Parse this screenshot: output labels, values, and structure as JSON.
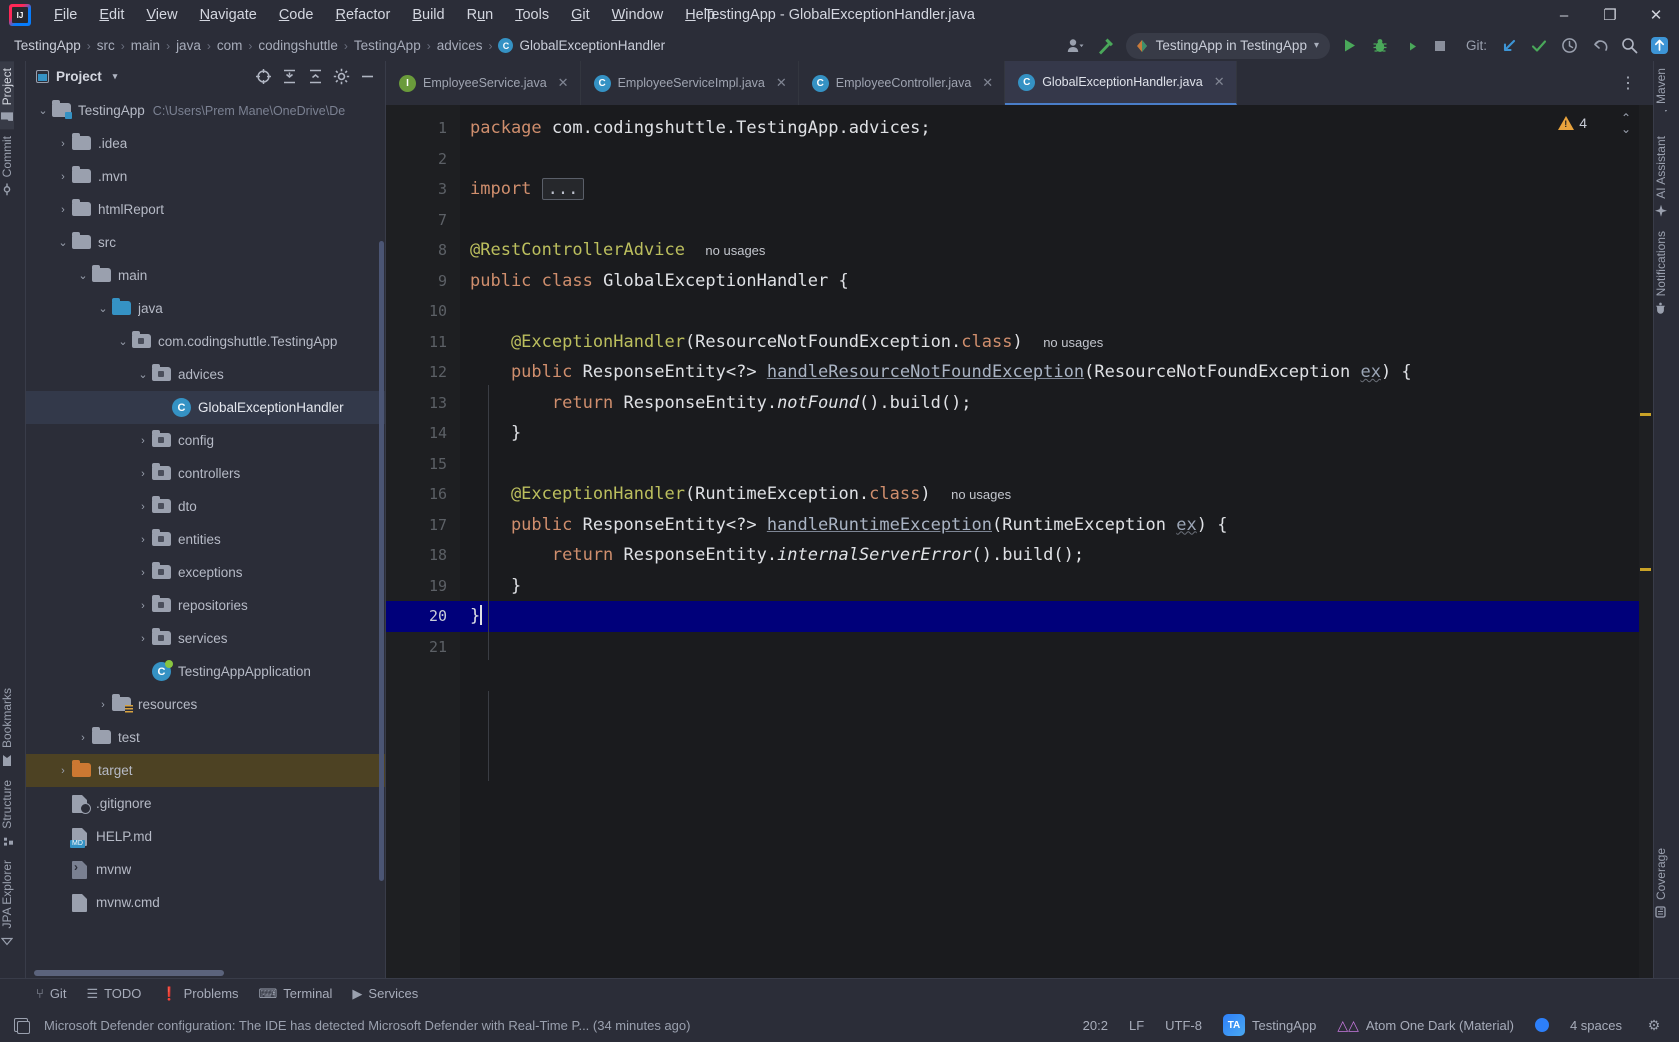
{
  "window": {
    "title": "TestingApp - GlobalExceptionHandler.java",
    "minimize": "–",
    "maximize": "❐",
    "close": "✕"
  },
  "menu": [
    {
      "label": "File",
      "mnemonic": "F"
    },
    {
      "label": "Edit",
      "mnemonic": "E"
    },
    {
      "label": "View",
      "mnemonic": "V"
    },
    {
      "label": "Navigate",
      "mnemonic": "N"
    },
    {
      "label": "Code",
      "mnemonic": "C"
    },
    {
      "label": "Refactor",
      "mnemonic": "R"
    },
    {
      "label": "Build",
      "mnemonic": "B"
    },
    {
      "label": "Run",
      "mnemonic": "u"
    },
    {
      "label": "Tools",
      "mnemonic": "T"
    },
    {
      "label": "Git",
      "mnemonic": "G"
    },
    {
      "label": "Window",
      "mnemonic": "W"
    },
    {
      "label": "Help",
      "mnemonic": "H"
    }
  ],
  "breadcrumb": {
    "items": [
      "TestingApp",
      "src",
      "main",
      "java",
      "com",
      "codingshuttle",
      "TestingApp",
      "advices"
    ],
    "current": "GlobalExceptionHandler",
    "current_icon": "class-icon",
    "separator": "›"
  },
  "toolbar": {
    "account_icon": "user-icon",
    "account_caret": "▾",
    "build_icon": "hammer-icon",
    "run_config": "TestingApp in TestingApp",
    "run_config_icon": "spring-boot-icon",
    "run_config_caret": "▾",
    "run_icon": "run-icon",
    "debug_icon": "debug-icon",
    "run_coverage_icon": "run-with-coverage-icon",
    "stop_icon": "stop-icon",
    "git_label": "Git:",
    "git_update_icon": "update-project-icon",
    "git_commit_icon": "commit-checkmark-icon",
    "git_history_icon": "history-clock-icon",
    "git_rollback_icon": "rollback-icon",
    "search_icon": "search-icon",
    "updates_icon": "updates-arrow-icon"
  },
  "left_rail": [
    {
      "label": "Project",
      "icon": "project-folder-icon",
      "active": true
    },
    {
      "label": "Commit",
      "icon": "commit-icon",
      "active": false
    },
    {
      "label": "Bookmarks",
      "icon": "bookmark-icon",
      "active": false
    },
    {
      "label": "Structure",
      "icon": "structure-icon",
      "active": false
    },
    {
      "label": "JPA Explorer",
      "icon": "jpa-icon",
      "active": false
    }
  ],
  "right_rail": [
    {
      "label": "Maven",
      "icon": "maven-m-icon"
    },
    {
      "label": "AI Assistant",
      "icon": "ai-assistant-icon"
    },
    {
      "label": "Notifications",
      "icon": "notifications-bell-icon"
    },
    {
      "label": "Coverage",
      "icon": "coverage-icon"
    }
  ],
  "project_panel": {
    "title": "Project",
    "caret": "▾",
    "actions": [
      {
        "name": "select-opened-file-icon",
        "glyph": "⊕"
      },
      {
        "name": "expand-all-icon",
        "glyph": "⤒"
      },
      {
        "name": "collapse-all-icon",
        "glyph": "⤓"
      },
      {
        "name": "settings-gear-icon",
        "glyph": "⚙"
      },
      {
        "name": "hide-panel-icon",
        "glyph": "—"
      }
    ],
    "tree": [
      {
        "label": "TestingApp",
        "path": "C:\\Users\\Prem Mane\\OneDrive\\De",
        "depth": 0,
        "arrow": "⌄",
        "icon": "project-root-folder",
        "state": "normal"
      },
      {
        "label": ".idea",
        "depth": 1,
        "arrow": "›",
        "icon": "folder",
        "state": "normal"
      },
      {
        "label": ".mvn",
        "depth": 1,
        "arrow": "›",
        "icon": "folder",
        "state": "normal"
      },
      {
        "label": "htmlReport",
        "depth": 1,
        "arrow": "›",
        "icon": "folder",
        "state": "normal"
      },
      {
        "label": "src",
        "depth": 1,
        "arrow": "⌄",
        "icon": "folder",
        "state": "normal"
      },
      {
        "label": "main",
        "depth": 2,
        "arrow": "⌄",
        "icon": "folder",
        "state": "normal"
      },
      {
        "label": "java",
        "depth": 3,
        "arrow": "⌄",
        "icon": "source-folder",
        "state": "normal"
      },
      {
        "label": "com.codingshuttle.TestingApp",
        "depth": 4,
        "arrow": "⌄",
        "icon": "package",
        "state": "normal"
      },
      {
        "label": "advices",
        "depth": 5,
        "arrow": "⌄",
        "icon": "package",
        "state": "normal"
      },
      {
        "label": "GlobalExceptionHandler",
        "depth": 6,
        "arrow": "",
        "icon": "java-class",
        "state": "selected"
      },
      {
        "label": "config",
        "depth": 5,
        "arrow": "›",
        "icon": "package",
        "state": "normal"
      },
      {
        "label": "controllers",
        "depth": 5,
        "arrow": "›",
        "icon": "package",
        "state": "normal"
      },
      {
        "label": "dto",
        "depth": 5,
        "arrow": "›",
        "icon": "package",
        "state": "normal"
      },
      {
        "label": "entities",
        "depth": 5,
        "arrow": "›",
        "icon": "package",
        "state": "normal"
      },
      {
        "label": "exceptions",
        "depth": 5,
        "arrow": "›",
        "icon": "package",
        "state": "normal"
      },
      {
        "label": "repositories",
        "depth": 5,
        "arrow": "›",
        "icon": "package",
        "state": "normal"
      },
      {
        "label": "services",
        "depth": 5,
        "arrow": "›",
        "icon": "package",
        "state": "normal"
      },
      {
        "label": "TestingAppApplication",
        "depth": 5,
        "arrow": "",
        "icon": "spring-class",
        "state": "normal"
      },
      {
        "label": "resources",
        "depth": 3,
        "arrow": "›",
        "icon": "resources-folder",
        "state": "normal"
      },
      {
        "label": "test",
        "depth": 2,
        "arrow": "›",
        "icon": "folder",
        "state": "normal"
      },
      {
        "label": "target",
        "depth": 1,
        "arrow": "›",
        "icon": "excluded-folder",
        "state": "highlighted"
      },
      {
        "label": ".gitignore",
        "depth": 1,
        "arrow": "",
        "icon": "gitignore-file",
        "state": "normal"
      },
      {
        "label": "HELP.md",
        "depth": 1,
        "arrow": "",
        "icon": "markdown-file",
        "state": "normal"
      },
      {
        "label": "mvnw",
        "depth": 1,
        "arrow": "",
        "icon": "shell-file",
        "state": "normal"
      },
      {
        "label": "mvnw.cmd",
        "depth": 1,
        "arrow": "",
        "icon": "file",
        "state": "normal"
      }
    ]
  },
  "editor_tabs": [
    {
      "label": "EmployeeService.java",
      "icon": "interface-icon",
      "letter": "I",
      "active": false,
      "close": "✕"
    },
    {
      "label": "EmployeeServiceImpl.java",
      "icon": "class-icon",
      "letter": "C",
      "active": false,
      "close": "✕"
    },
    {
      "label": "EmployeeController.java",
      "icon": "class-icon",
      "letter": "C",
      "active": false,
      "close": "✕"
    },
    {
      "label": "GlobalExceptionHandler.java",
      "icon": "class-icon",
      "letter": "C",
      "active": true,
      "close": "✕"
    }
  ],
  "editor_overflow_icon": "more-options-icon",
  "editor": {
    "warning_count": "4",
    "warning_icon": "warning-triangle-icon",
    "prev_problem_icon": "⌃",
    "next_problem_icon": "⌄",
    "line_numbers": [
      "1",
      "2",
      "3",
      "7",
      "8",
      "9",
      "10",
      "11",
      "12",
      "13",
      "14",
      "15",
      "16",
      "17",
      "18",
      "19",
      "20",
      "21"
    ],
    "current_line": "20",
    "lines": [
      {
        "num": "1",
        "tokens": [
          {
            "t": "package",
            "c": "kw"
          },
          {
            "t": " com.codingshuttle.TestingApp.advices;",
            "c": "pl"
          }
        ]
      },
      {
        "num": "2",
        "tokens": []
      },
      {
        "num": "3",
        "tokens": [
          {
            "t": "import",
            "c": "kw"
          },
          {
            "t": " ",
            "c": "pl"
          },
          {
            "t": "...",
            "c": "importbox"
          }
        ],
        "fold": "plus"
      },
      {
        "num": "7",
        "tokens": []
      },
      {
        "num": "8",
        "tokens": [
          {
            "t": "@RestControllerAdvice",
            "c": "ann"
          },
          {
            "t": "  ",
            "c": "pl"
          },
          {
            "t": "no usages",
            "c": "usages"
          }
        ]
      },
      {
        "num": "9",
        "tokens": [
          {
            "t": "public class",
            "c": "kw"
          },
          {
            "t": " GlobalExceptionHandler ",
            "c": "pl"
          },
          {
            "t": "{",
            "c": "brace"
          }
        ]
      },
      {
        "num": "10",
        "tokens": []
      },
      {
        "num": "11",
        "tokens": [
          {
            "t": "    @ExceptionHandler",
            "c": "ann"
          },
          {
            "t": "(ResourceNotFoundException.",
            "c": "pl"
          },
          {
            "t": "class",
            "c": "kw"
          },
          {
            "t": ")",
            "c": "pl"
          },
          {
            "t": "  ",
            "c": "pl"
          },
          {
            "t": "no usages",
            "c": "usages"
          }
        ]
      },
      {
        "num": "12",
        "tokens": [
          {
            "t": "    public",
            "c": "kw"
          },
          {
            "t": " ResponseEntity<?> ",
            "c": "pl"
          },
          {
            "t": "handleResourceNotFoundException",
            "c": "mth"
          },
          {
            "t": "(ResourceNotFoundException ",
            "c": "pl"
          },
          {
            "t": "ex",
            "c": "param"
          },
          {
            "t": ") {",
            "c": "pl"
          }
        ],
        "fold": "minus"
      },
      {
        "num": "13",
        "tokens": [
          {
            "t": "        return",
            "c": "kw"
          },
          {
            "t": " ResponseEntity.",
            "c": "pl"
          },
          {
            "t": "notFound",
            "c": "ital"
          },
          {
            "t": "().build();",
            "c": "pl"
          }
        ]
      },
      {
        "num": "14",
        "tokens": [
          {
            "t": "    }",
            "c": "pl"
          }
        ],
        "fold": "end"
      },
      {
        "num": "15",
        "tokens": []
      },
      {
        "num": "16",
        "tokens": [
          {
            "t": "    @ExceptionHandler",
            "c": "ann"
          },
          {
            "t": "(RuntimeException.",
            "c": "pl"
          },
          {
            "t": "class",
            "c": "kw"
          },
          {
            "t": ")",
            "c": "pl"
          },
          {
            "t": "  ",
            "c": "pl"
          },
          {
            "t": "no usages",
            "c": "usages"
          }
        ]
      },
      {
        "num": "17",
        "tokens": [
          {
            "t": "    public",
            "c": "kw"
          },
          {
            "t": " ResponseEntity<?> ",
            "c": "pl"
          },
          {
            "t": "handleRuntimeException",
            "c": "mth"
          },
          {
            "t": "(RuntimeException ",
            "c": "pl"
          },
          {
            "t": "ex",
            "c": "param"
          },
          {
            "t": ") {",
            "c": "pl"
          }
        ],
        "fold": "minus"
      },
      {
        "num": "18",
        "tokens": [
          {
            "t": "        return",
            "c": "kw"
          },
          {
            "t": " ResponseEntity.",
            "c": "pl"
          },
          {
            "t": "internalServerError",
            "c": "ital"
          },
          {
            "t": "().build();",
            "c": "pl"
          }
        ]
      },
      {
        "num": "19",
        "tokens": [
          {
            "t": "    }",
            "c": "pl"
          }
        ],
        "fold": "end"
      },
      {
        "num": "20",
        "tokens": [
          {
            "t": "}",
            "c": "pl"
          }
        ],
        "current": true
      },
      {
        "num": "21",
        "tokens": []
      }
    ]
  },
  "bottom_tools": [
    {
      "label": "Git",
      "icon": "git-branch-icon",
      "glyph": "⑂"
    },
    {
      "label": "TODO",
      "icon": "todo-list-icon",
      "glyph": "☰"
    },
    {
      "label": "Problems",
      "icon": "problems-icon",
      "glyph": "❗"
    },
    {
      "label": "Terminal",
      "icon": "terminal-icon",
      "glyph": "⌨"
    },
    {
      "label": "Services",
      "icon": "services-play-icon",
      "glyph": "▶"
    }
  ],
  "statusbar": {
    "message_icon": "notification-copy-icon",
    "message": "Microsoft Defender configuration: The IDE has detected Microsoft Defender with Real-Time P... (34 minutes ago)",
    "caret_position": "20:2",
    "line_separator": "LF",
    "encoding": "UTF-8",
    "module_badge": "TA",
    "module": "TestingApp",
    "theme_icon": "atom-theme-icon",
    "theme": "Atom One Dark (Material)",
    "indicator_icon": "blue-dot-icon",
    "indent": "4 spaces",
    "settings_icon": "⚙"
  },
  "colors": {
    "accent": "#3592c4",
    "warning": "#e8a33d",
    "keyword": "#cf8e6d",
    "annotation": "#bcbf5e",
    "plain": "#dfe1e5",
    "current_line": "#00007a",
    "excluded": "#cc7832"
  }
}
